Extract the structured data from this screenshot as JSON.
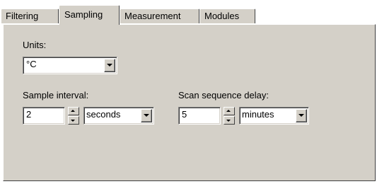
{
  "tabs": [
    {
      "label": "Filtering"
    },
    {
      "label": "Sampling",
      "active": true
    },
    {
      "label": "Measurement"
    },
    {
      "label": "Modules"
    }
  ],
  "sampling": {
    "units": {
      "label": "Units:",
      "value": "°C"
    },
    "sample_interval": {
      "label": "Sample interval:",
      "value": "2",
      "unit": "seconds"
    },
    "scan_delay": {
      "label": "Scan sequence delay:",
      "value": "5",
      "unit": "minutes"
    }
  },
  "colors": {
    "face": "#d4d0c8",
    "highlight": "#ffffff",
    "shadow": "#808080",
    "dark_shadow": "#404040"
  }
}
